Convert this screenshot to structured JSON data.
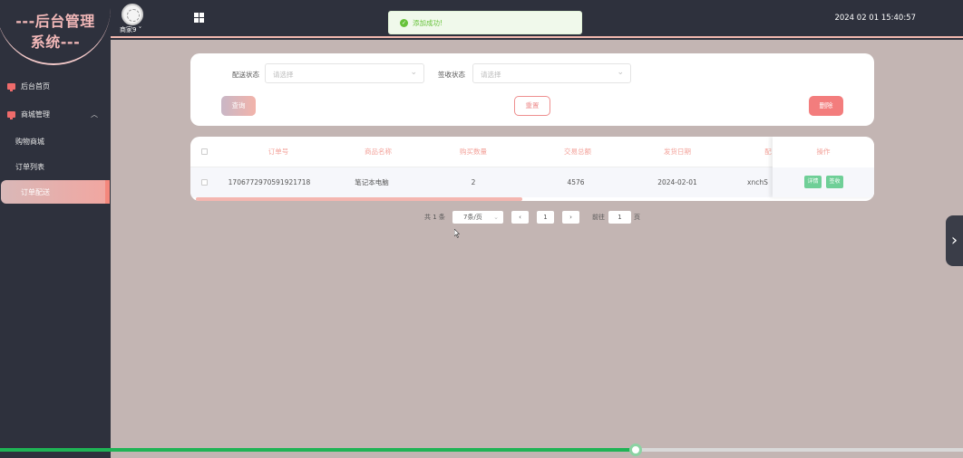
{
  "sidebar": {
    "logo_line1": "---后台管理",
    "logo_line2": "系统---",
    "home": "后台首页",
    "shop_mgmt": "商城管理",
    "sub_items": [
      "购物商城",
      "订单列表",
      "订单配送"
    ]
  },
  "topbar": {
    "username": "商家9",
    "title_fragment": "",
    "datetime": "2024 02 01 15:40:57"
  },
  "toast": {
    "message": "添加成功!"
  },
  "search": {
    "delivery_label": "配送状态",
    "delivery_placeholder": "请选择",
    "receipt_label": "签收状态",
    "receipt_placeholder": "请选择",
    "query_button": "查询",
    "reset_button": "重置",
    "delete_button": "删除"
  },
  "table": {
    "headers": [
      "订单号",
      "商品名称",
      "购买数量",
      "交易总额",
      "发货日期",
      "配",
      "操作"
    ],
    "rows": [
      {
        "order_no": "1706772970591921718",
        "product": "笔记本电脑",
        "quantity": "2",
        "total": "4576",
        "ship_date": "2024-02-01",
        "delivery": "xnchS",
        "action_detail": "详情",
        "action_sign": "签收"
      }
    ]
  },
  "pagination": {
    "total": "共 1 条",
    "page_size": "7条/页",
    "prev": "‹",
    "current": "1",
    "next": "›",
    "goto_label": "前往",
    "goto_value": "1",
    "page_suffix": "页"
  },
  "media_progress": {
    "value": 0.66
  },
  "colors": {
    "accent": "#f37d7d",
    "success": "#67c23a",
    "sidebar": "#2e313d"
  }
}
